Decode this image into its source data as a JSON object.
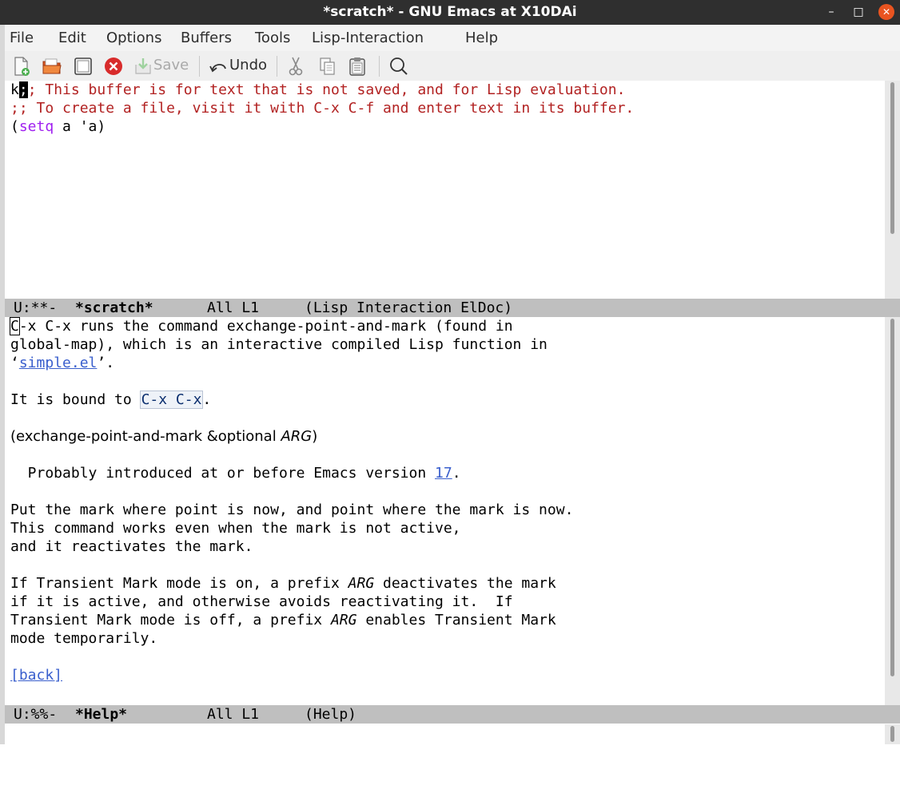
{
  "window": {
    "title": "*scratch* - GNU Emacs at X10DAi",
    "minimize": "–",
    "maximize": "□",
    "close": "✕"
  },
  "menubar": [
    "File",
    "Edit",
    "Options",
    "Buffers",
    "Tools",
    "Lisp-Interaction",
    "Help"
  ],
  "toolbar": {
    "save_label": "Save",
    "undo_label": "Undo",
    "icons": [
      "new-file-icon",
      "open-folder-icon",
      "dired-icon",
      "close-buffer-icon",
      "save-icon",
      "undo-icon",
      "cut-icon",
      "copy-icon",
      "paste-icon",
      "search-icon"
    ]
  },
  "scratch": {
    "line1_typed": "k",
    "line1_cursor_char": ";",
    "line1_comment_rest": "; This buffer is for text that is not saved, and for Lisp evaluation.",
    "line2": ";; To create a file, visit it with C-x C-f and enter text in its buffer.",
    "line3_open": "(",
    "line3_kw": "setq",
    "line3_rest": " a 'a)"
  },
  "modeline_scratch": {
    "status": "U:**-",
    "buffer": "*scratch*",
    "position": "All L1",
    "mode": "(Lisp Interaction ElDoc)"
  },
  "help": {
    "l1_cursor": "C",
    "l1_rest": "-x C-x runs the command exchange-point-and-mark (found in",
    "l2": "global-map), which is an interactive compiled Lisp function in",
    "l3_quote_open": "‘",
    "l3_link": "simple.el",
    "l3_quote_close": "’.",
    "l4_prefix": "It is bound to ",
    "l4_key": "C-x C-x",
    "l4_suffix": ".",
    "l5_pre": "(exchange-point-and-mark &optional ",
    "l5_arg": "ARG",
    "l5_post": ")",
    "l6_pre": "  Probably introduced at or before Emacs version ",
    "l6_link": "17",
    "l6_post": ".",
    "p1": "Put the mark where point is now, and point where the mark is now.",
    "p2": "This command works even when the mark is not active,",
    "p3": "and it reactivates the mark.",
    "q1_pre": "If Transient Mark mode is on, a prefix ",
    "q1_arg": "ARG",
    "q1_post": " deactivates the mark",
    "q2": "if it is active, and otherwise avoids reactivating it.  If",
    "q3_pre": "Transient Mark mode is off, a prefix ",
    "q3_arg": "ARG",
    "q3_post": " enables Transient Mark",
    "q4": "mode temporarily.",
    "back": "[back]"
  },
  "modeline_help": {
    "status": "U:%%-",
    "buffer": "*Help*",
    "position": "All L1",
    "mode": "(Help)"
  }
}
